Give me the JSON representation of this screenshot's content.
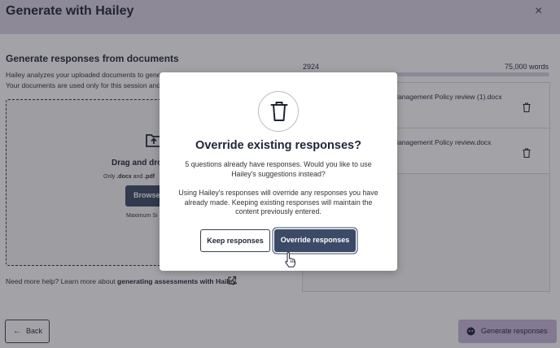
{
  "header": {
    "title": "Generate with Hailey",
    "close_icon": "×"
  },
  "main": {
    "section_title": "Generate responses from documents",
    "desc_line1": "Hailey analyzes your uploaded documents to genera",
    "desc_line2": "Your documents are used only for this session and w"
  },
  "dropzone": {
    "title": "Drag and drop",
    "only_prefix": "Only ",
    "docx": ".docx",
    "and": " and ",
    "pdf": ".pdf",
    "browse_label": "Browse",
    "max_label": "Maximum Si"
  },
  "help": {
    "text": "Need more help? Learn more about ",
    "link": "generating assessments with Hailey."
  },
  "word_count": {
    "current": "2924",
    "max": "75,000 words",
    "fraction": 0.039
  },
  "files": [
    {
      "name": "Management Policy review (1).docx"
    },
    {
      "name": "Management Policy review.docx"
    }
  ],
  "footer": {
    "back_label": "Back",
    "back_arrow": "←",
    "generate_label": "Generate responses"
  },
  "modal": {
    "title": "Override existing responses?",
    "paragraph1": "5 questions already have responses. Would you like to use Hailey's suggestions instead?",
    "paragraph2": "Using Hailey's responses will override any responses you have already made. Keeping existing responses will maintain the content previously entered.",
    "keep_label": "Keep responses",
    "override_label": "Override responses"
  },
  "colors": {
    "header_bg": "#d9d2e4",
    "primary": "#3b4a66",
    "accent_lavender": "#c8b7dc"
  },
  "icons": [
    "close-icon",
    "folder-upload-icon",
    "external-link-icon",
    "trash-icon",
    "arrow-left-icon",
    "hailey-bot-icon",
    "pointer-cursor-icon"
  ]
}
